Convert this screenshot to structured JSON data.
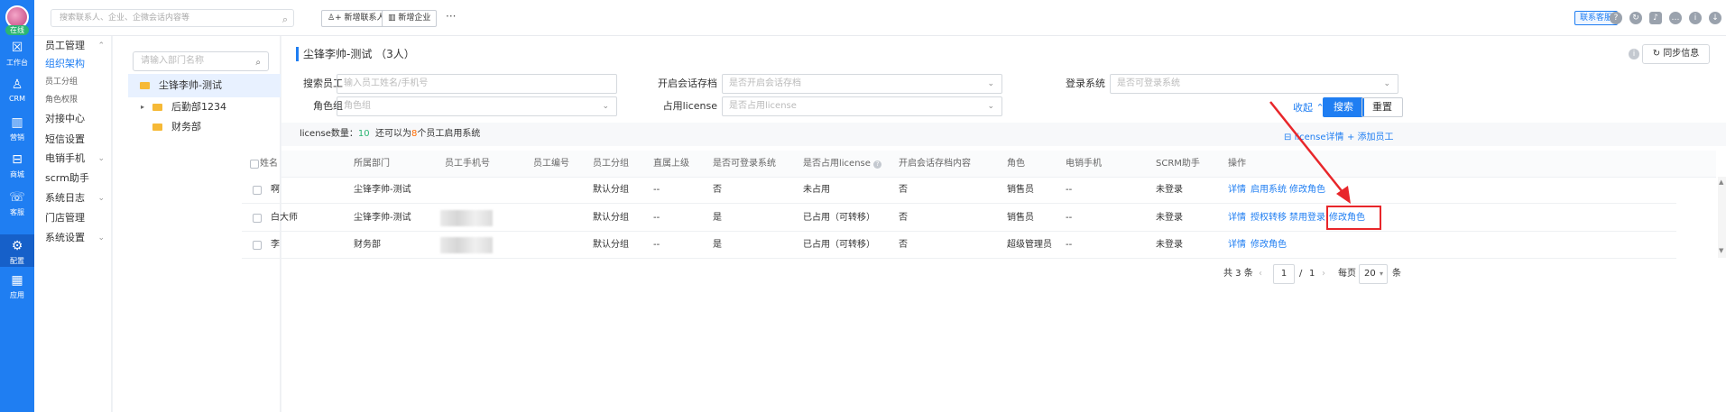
{
  "rail": {
    "online": "在线",
    "items": [
      {
        "icon": "workbench-icon",
        "glyph": "☒",
        "label": "工作台"
      },
      {
        "icon": "crm-icon",
        "glyph": "♙",
        "label": "CRM"
      },
      {
        "icon": "marketing-icon",
        "glyph": "▥",
        "label": "营销"
      },
      {
        "icon": "mall-icon",
        "glyph": "⊟",
        "label": "商城"
      },
      {
        "icon": "service-icon",
        "glyph": "☏",
        "label": "客服"
      },
      {
        "icon": "config-icon",
        "glyph": "⚙",
        "label": "配置"
      },
      {
        "icon": "apps-icon",
        "glyph": "▦",
        "label": "应用"
      }
    ]
  },
  "sidebar": {
    "items": [
      {
        "label": "员工管理",
        "chev": "⌃",
        "type": "group"
      },
      {
        "label": "组织架构",
        "type": "active"
      },
      {
        "label": "员工分组",
        "type": "sub"
      },
      {
        "label": "角色权限",
        "type": "sub"
      },
      {
        "label": "对接中心",
        "type": "item"
      },
      {
        "label": "短信设置",
        "type": "item"
      },
      {
        "label": "电销手机",
        "chev": "⌄",
        "type": "group"
      },
      {
        "label": "scrm助手",
        "type": "item"
      },
      {
        "label": "系统日志",
        "chev": "⌄",
        "type": "group"
      },
      {
        "label": "门店管理",
        "type": "item"
      },
      {
        "label": "系统设置",
        "chev": "⌄",
        "type": "group"
      }
    ]
  },
  "topbar": {
    "search_placeholder": "搜索联系人、企业、企微会话内容等",
    "new_contact": "新增联系人",
    "new_company": "新增企业",
    "more": "···",
    "service": "联系客服"
  },
  "tree": {
    "search_placeholder": "请输入部门名称",
    "nodes": [
      {
        "label": "尘锋李帅-测试",
        "selected": true
      },
      {
        "label": "后勤部1234",
        "caret": "▸"
      },
      {
        "label": "财务部"
      }
    ]
  },
  "main": {
    "title": "尘锋李帅-测试 （3人）",
    "sync": "同步信息",
    "filters": {
      "search_emp_label": "搜索员工",
      "search_emp_ph": "输入员工姓名/手机号",
      "archive_label": "开启会话存档",
      "archive_ph": "是否开启会话存档",
      "login_label": "登录系统",
      "login_ph": "是否可登录系统",
      "role_label": "角色组",
      "role_ph": "角色组",
      "license_label": "占用license",
      "license_ph": "是否占用license",
      "collapse": "收起 ⌃",
      "search_btn": "搜索",
      "reset_btn": "重置"
    },
    "license": {
      "prefix": "license数量：",
      "count": "10",
      "mid": "还可以为",
      "remain": "8",
      "suffix": "个员工启用系统",
      "detail": "license详情",
      "add": "+ 添加员工"
    },
    "columns": [
      "姓名",
      "所属部门",
      "员工手机号",
      "员工编号",
      "员工分组",
      "直属上级",
      "是否可登录系统",
      "是否占用license",
      "开启会话存档内容",
      "角色",
      "电销手机",
      "SCRM助手",
      "操作"
    ],
    "rows": [
      {
        "name": "啊",
        "dept": "尘锋李帅-测试",
        "phone_hidden": false,
        "group": "默认分组",
        "leader": "--",
        "login": "否",
        "license": "未占用",
        "archive": "否",
        "role": "销售员",
        "mobile": "--",
        "scrm": "未登录",
        "ops": [
          "详情",
          "启用系统",
          "修改角色"
        ]
      },
      {
        "name": "白大师",
        "dept": "尘锋李帅-测试",
        "phone_hidden": true,
        "group": "默认分组",
        "leader": "--",
        "login": "是",
        "license": "已占用（可转移）",
        "archive": "否",
        "role": "销售员",
        "mobile": "--",
        "scrm": "未登录",
        "ops": [
          "详情",
          "授权转移",
          "禁用登录",
          "修改角色"
        ]
      },
      {
        "name": "李",
        "dept": "财务部",
        "phone_hidden": true,
        "group": "默认分组",
        "leader": "--",
        "login": "是",
        "license": "已占用（可转移）",
        "archive": "否",
        "role": "超级管理员",
        "mobile": "--",
        "scrm": "未登录",
        "ops": [
          "详情",
          "修改角色"
        ]
      }
    ],
    "pagination": {
      "total": "共 3 条",
      "prev": "‹",
      "page": "1",
      "sep": "/",
      "pages": "1",
      "next": "›",
      "per_label": "每页",
      "per": "20",
      "unit": "条"
    }
  },
  "colors": {
    "accent": "#1f7ef2",
    "highlight": "#e8262a",
    "success": "#2bb673",
    "warn": "#ff6a00"
  }
}
